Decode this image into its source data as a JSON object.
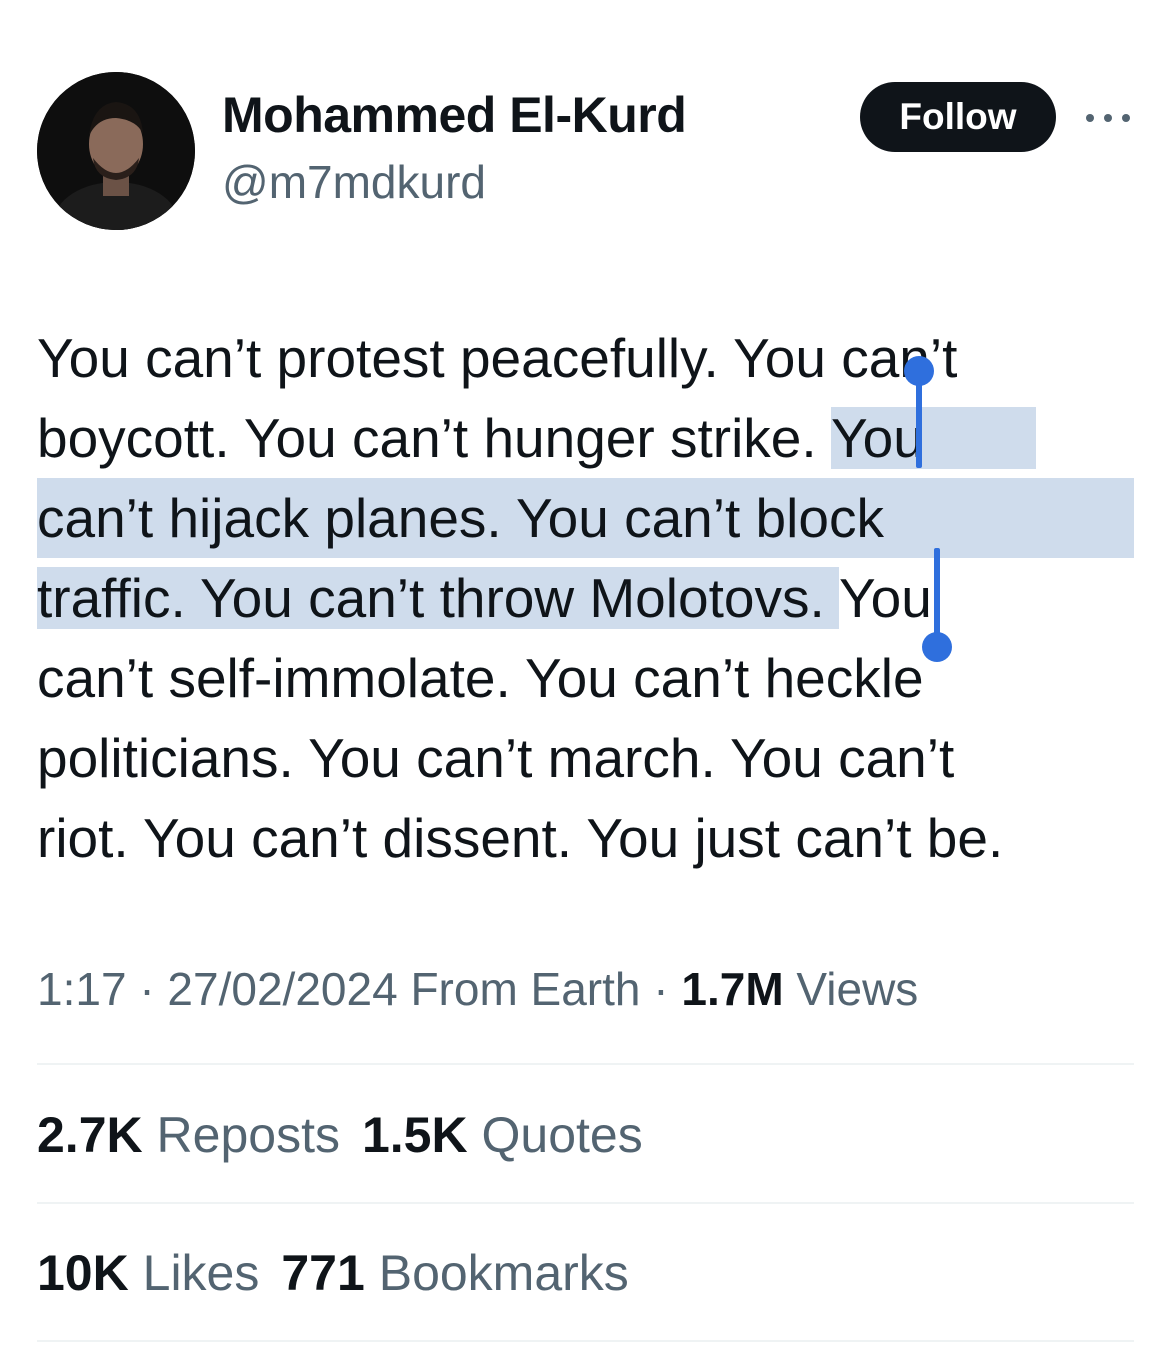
{
  "author": {
    "display_name": "Mohammed El-Kurd",
    "handle": "@m7mdkurd"
  },
  "follow_label": "Follow",
  "tweet": {
    "lines": [
      {
        "plain": "You can’t protest peacefully. You can’t",
        "highlighted": ""
      },
      {
        "plain": "boycott. You can’t hunger strike. ",
        "highlighted": "You"
      },
      {
        "plain": "",
        "highlighted": "can’t hijack planes. You can’t block"
      },
      {
        "plain": "",
        "highlighted": "traffic. You can’t throw Molotovs. ",
        "after": "You"
      },
      {
        "plain": "can’t self-immolate. You can’t heckle",
        "highlighted": ""
      },
      {
        "plain": "politicians. You can’t march. You can’t",
        "highlighted": ""
      },
      {
        "plain": "riot. You can’t dissent. You just can’t be.",
        "highlighted": ""
      }
    ]
  },
  "meta": {
    "time": "1:17",
    "sep1": "·",
    "date": "27/02/2024",
    "source": "From Earth",
    "sep2": "·",
    "views_count": "1.7M",
    "views_label": "Views"
  },
  "stats": {
    "reposts_count": "2.7K",
    "reposts_label": "Reposts",
    "quotes_count": "1.5K",
    "quotes_label": "Quotes",
    "likes_count": "10K",
    "likes_label": "Likes",
    "bookmarks_count": "771",
    "bookmarks_label": "Bookmarks"
  },
  "colors": {
    "selection_highlight": "#cfdcec",
    "selection_handle": "#2f6fdd",
    "secondary_text": "#536471",
    "primary_text": "#0f1419"
  }
}
